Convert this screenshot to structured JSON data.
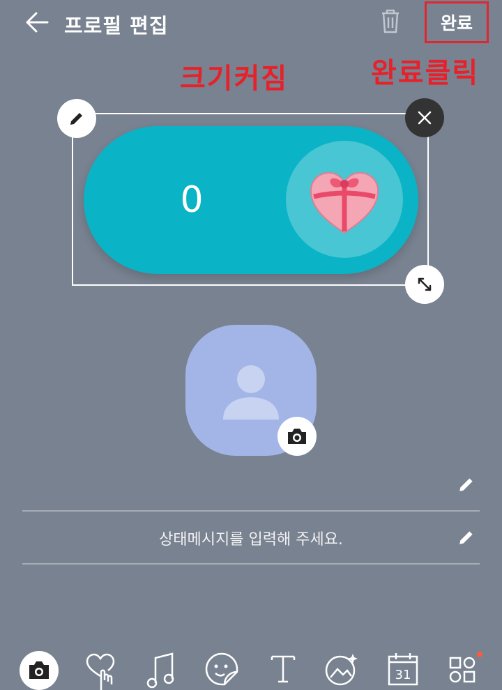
{
  "header": {
    "title": "프로필 편집",
    "done_label": "완료"
  },
  "annotations": {
    "enlarged": "크기커짐",
    "click_done": "완료클릭"
  },
  "sticker": {
    "count": "0"
  },
  "status_message": {
    "placeholder": "상태메시지를 입력해 주세요."
  },
  "toolbar": {
    "items": [
      {
        "icon": "camera-icon"
      },
      {
        "icon": "heart-hand-icon"
      },
      {
        "icon": "music-note-icon"
      },
      {
        "icon": "sticker-icon"
      },
      {
        "icon": "text-icon"
      },
      {
        "icon": "photo-sparkle-icon"
      },
      {
        "icon": "calendar-icon",
        "label": "31"
      },
      {
        "icon": "widgets-icon"
      }
    ]
  },
  "colors": {
    "background": "#788290",
    "accent_red": "#e8202a",
    "pill": "#0bb3c6",
    "avatar": "#a2b5e6"
  }
}
